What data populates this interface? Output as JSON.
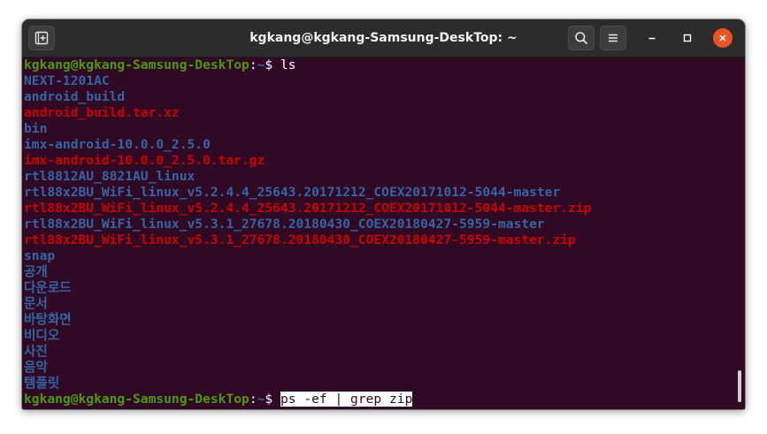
{
  "window": {
    "title": "kgkang@kgkang-Samsung-DeskTop: ~"
  },
  "icons": {
    "new_tab": "new-tab-icon",
    "search": "search-icon",
    "menu": "hamburger-menu-icon",
    "minimize": "minimize-icon",
    "maximize": "maximize-icon",
    "close": "close-icon"
  },
  "colors": {
    "terminal_background": "#300a24",
    "prompt_user": "#4e9a06",
    "directory": "#3465a4",
    "archive": "#cc0000",
    "close_button": "#e95420"
  },
  "terminal": {
    "prompt1": {
      "user_host": "kgkang@kgkang-Samsung-DeskTop",
      "separator": ":",
      "path": "~",
      "symbol": "$ ",
      "command": "ls"
    },
    "listing": [
      {
        "name": "NEXT-1201AC",
        "type": "dir"
      },
      {
        "name": "android_build",
        "type": "dir"
      },
      {
        "name": "android_build.tar.xz",
        "type": "archive"
      },
      {
        "name": "bin",
        "type": "dir"
      },
      {
        "name": "imx-android-10.0.0_2.5.0",
        "type": "dir"
      },
      {
        "name": "imx-android-10.0.0_2.5.0.tar.gz",
        "type": "archive"
      },
      {
        "name": "rtl8812AU_8821AU_linux",
        "type": "dir"
      },
      {
        "name": "rtl88x2BU_WiFi_linux_v5.2.4.4_25643.20171212_COEX20171012-5044-master",
        "type": "dir"
      },
      {
        "name": "rtl88x2BU_WiFi_linux_v5.2.4.4_25643.20171212_COEX20171012-5044-master.zip",
        "type": "archive"
      },
      {
        "name": "rtl88x2BU_WiFi_linux_v5.3.1_27678.20180430_COEX20180427-5959-master",
        "type": "dir"
      },
      {
        "name": "rtl88x2BU_WiFi_linux_v5.3.1_27678.20180430_COEX20180427-5959-master.zip",
        "type": "archive"
      },
      {
        "name": "snap",
        "type": "dir"
      },
      {
        "name": "공개",
        "type": "dir"
      },
      {
        "name": "다운로드",
        "type": "dir"
      },
      {
        "name": "문서",
        "type": "dir"
      },
      {
        "name": "바탕화면",
        "type": "dir"
      },
      {
        "name": "비디오",
        "type": "dir"
      },
      {
        "name": "사진",
        "type": "dir"
      },
      {
        "name": "음악",
        "type": "dir"
      },
      {
        "name": "템플릿",
        "type": "dir"
      }
    ],
    "prompt2": {
      "user_host": "kgkang@kgkang-Samsung-DeskTop",
      "separator": ":",
      "path": "~",
      "symbol": "$ ",
      "command": "ps -ef | grep zip"
    }
  }
}
